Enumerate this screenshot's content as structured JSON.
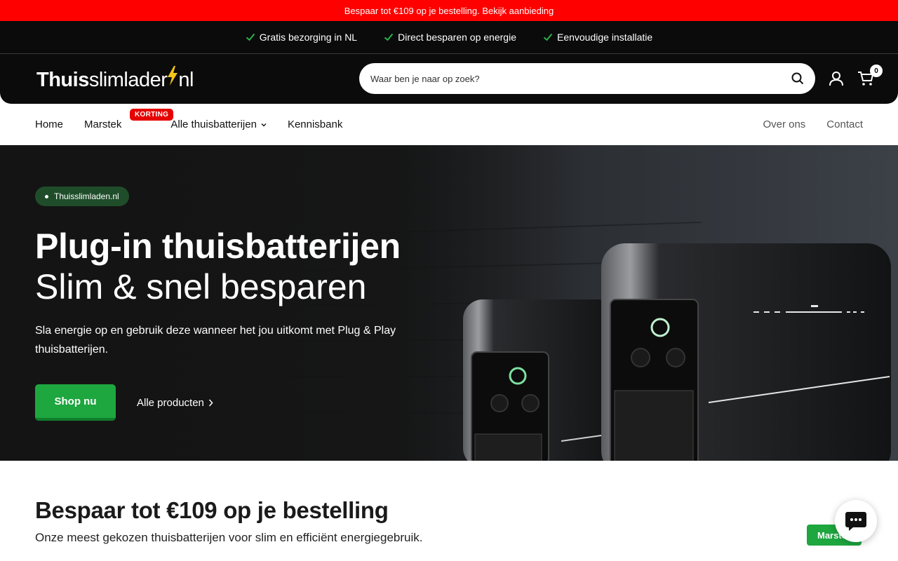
{
  "announcement": {
    "text": "Bespaar tot €109 op je bestelling. Bekijk aanbieding"
  },
  "usps": [
    {
      "label": "Gratis bezorging in NL",
      "icon": "check-icon"
    },
    {
      "label": "Direct besparen op energie",
      "icon": "check-icon"
    },
    {
      "label": "Eenvoudige installatie",
      "icon": "check-icon"
    }
  ],
  "header": {
    "logo_bold": "Thuis",
    "logo_regular": "slimlader",
    "logo_suffix": "nl",
    "search_placeholder": "Waar ben je naar op zoek?",
    "cart_count": "0"
  },
  "nav": {
    "home": "Home",
    "marstek": "Marstek",
    "marstek_badge": "KORTING",
    "all_batteries": "Alle thuisbatterijen",
    "knowledge": "Kennisbank",
    "about": "Over ons",
    "contact": "Contact"
  },
  "hero": {
    "pill": "Thuisslimladen.nl",
    "title": "Plug-in thuisbatterijen",
    "subtitle": "Slim & snel besparen",
    "text": "Sla energie op en gebruik deze wanneer het jou uitkomt met Plug & Play thuisbatterijen.",
    "cta_primary": "Shop nu",
    "cta_secondary": "Alle producten"
  },
  "section": {
    "title": "Bespaar tot €109 op je bestelling",
    "subtitle": "Onze meest gekozen thuisbatterijen voor slim en efficiënt energiegebruik.",
    "button": "Marstek"
  },
  "colors": {
    "announce": "#ff0000",
    "header": "#0b0b0b",
    "green": "#1ea63f",
    "badge": "#e60000"
  }
}
